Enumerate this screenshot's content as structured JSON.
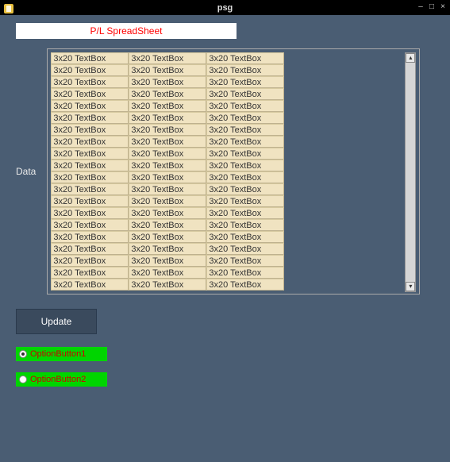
{
  "window": {
    "title": "psg"
  },
  "header": {
    "label": "P/L SpreadSheet"
  },
  "data_section": {
    "label": "Data",
    "cell_text": "3x20 TextBox",
    "rows": 20,
    "cols": 3
  },
  "buttons": {
    "update": "Update"
  },
  "radios": [
    {
      "label": "OptionButton1",
      "selected": true
    },
    {
      "label": "OptionButton2",
      "selected": false
    }
  ],
  "scrollbar": {
    "up": "▴",
    "down": "▾"
  },
  "window_controls": {
    "min": "–",
    "max": "□",
    "close": "×"
  }
}
